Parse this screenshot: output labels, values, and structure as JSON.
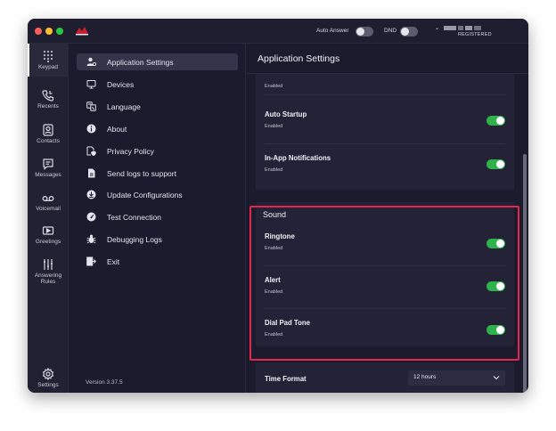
{
  "titlebar": {
    "auto_answer_label": "Auto Answer",
    "dnd_label": "DND",
    "user_status": "REGISTERED"
  },
  "rail": {
    "items": [
      {
        "label": "Keypad",
        "icon": "keypad-icon"
      },
      {
        "label": "Recents",
        "icon": "recents-icon"
      },
      {
        "label": "Contacts",
        "icon": "contacts-icon"
      },
      {
        "label": "Messages",
        "icon": "messages-icon"
      },
      {
        "label": "Voicemail",
        "icon": "voicemail-icon"
      },
      {
        "label": "Greetings",
        "icon": "greetings-icon"
      },
      {
        "label": "Answering\nRules",
        "icon": "answering-rules-icon"
      },
      {
        "label": "Settings",
        "icon": "settings-icon"
      }
    ]
  },
  "menu": {
    "items": [
      {
        "label": "Application Settings",
        "icon": "app-settings-icon"
      },
      {
        "label": "Devices",
        "icon": "devices-icon"
      },
      {
        "label": "Language",
        "icon": "language-icon"
      },
      {
        "label": "About",
        "icon": "info-icon"
      },
      {
        "label": "Privacy Policy",
        "icon": "privacy-icon"
      },
      {
        "label": "Send logs to support",
        "icon": "send-logs-icon"
      },
      {
        "label": "Update Configurations",
        "icon": "download-icon"
      },
      {
        "label": "Test Connection",
        "icon": "gauge-icon"
      },
      {
        "label": "Debugging Logs",
        "icon": "bug-icon"
      },
      {
        "label": "Exit",
        "icon": "exit-icon"
      }
    ],
    "version": "Version 3.37.5"
  },
  "content": {
    "title": "Application Settings",
    "top_partial_status": "Enabled",
    "general_rows": [
      {
        "title": "Auto Startup",
        "status": "Enabled"
      },
      {
        "title": "In-App Notifications",
        "status": "Enabled"
      }
    ],
    "sound_section": {
      "title": "Sound",
      "rows": [
        {
          "title": "Ringtone",
          "status": "Enabled"
        },
        {
          "title": "Alert",
          "status": "Enabled"
        },
        {
          "title": "Dial Pad Tone",
          "status": "Enabled"
        }
      ]
    },
    "time_format": {
      "label": "Time Format",
      "value": "12 hours"
    }
  },
  "colors": {
    "toggle_on": "#2fb24c",
    "highlight_border": "#e0284c",
    "background": "#1c1b2d"
  }
}
